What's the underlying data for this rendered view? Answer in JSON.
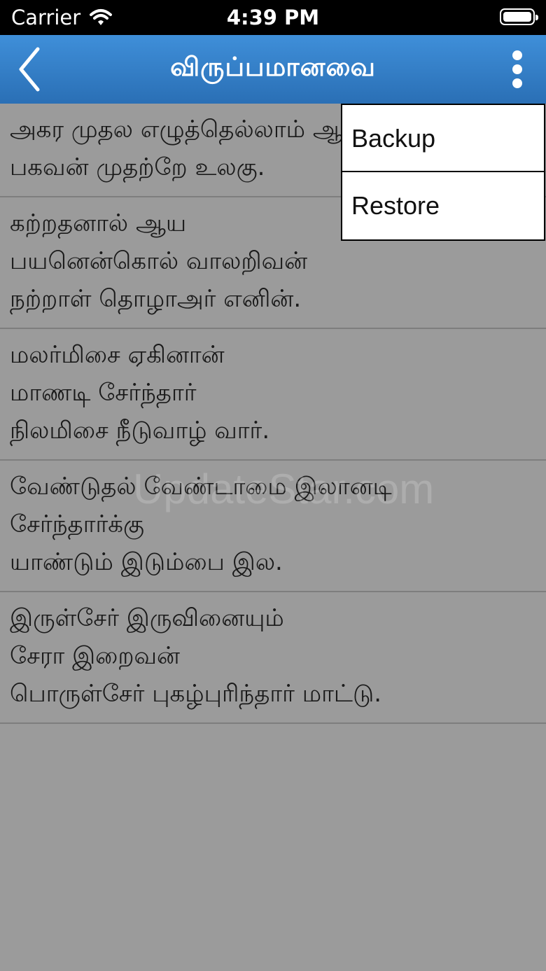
{
  "status_bar": {
    "carrier": "Carrier",
    "time": "4:39 PM"
  },
  "nav": {
    "title": "விருப்பமானவை",
    "back_icon": "chevron-left-icon",
    "menu_icon": "more-vertical-icon"
  },
  "watermark": "UpdateStar.com",
  "items": [
    {
      "lines": [
        "அகர முதல எழுத்தெல்லாம் ஆதி",
        "பகவன் முதற்றே உலகு."
      ]
    },
    {
      "lines": [
        "கற்றதனால் ஆய",
        "பயனென்கொல் வாலறிவன்",
        "நற்றாள் தொழாஅர் எனின்."
      ]
    },
    {
      "lines": [
        "மலர்மிசை ஏகினான்",
        "மாணடி சேர்ந்தார்",
        "நிலமிசை நீடுவாழ் வார்."
      ]
    },
    {
      "lines": [
        "வேண்டுதல் வேண்டாமை இலானடி",
        "சேர்ந்தார்க்கு",
        "யாண்டும் இடும்பை இல."
      ]
    },
    {
      "lines": [
        "இருள்சேர் இருவினையும்",
        "சேரா இறைவன்",
        "பொருள்சேர் புகழ்புரிந்தார் மாட்டு."
      ]
    }
  ],
  "popup_menu": {
    "items": [
      "Backup",
      "Restore"
    ]
  }
}
